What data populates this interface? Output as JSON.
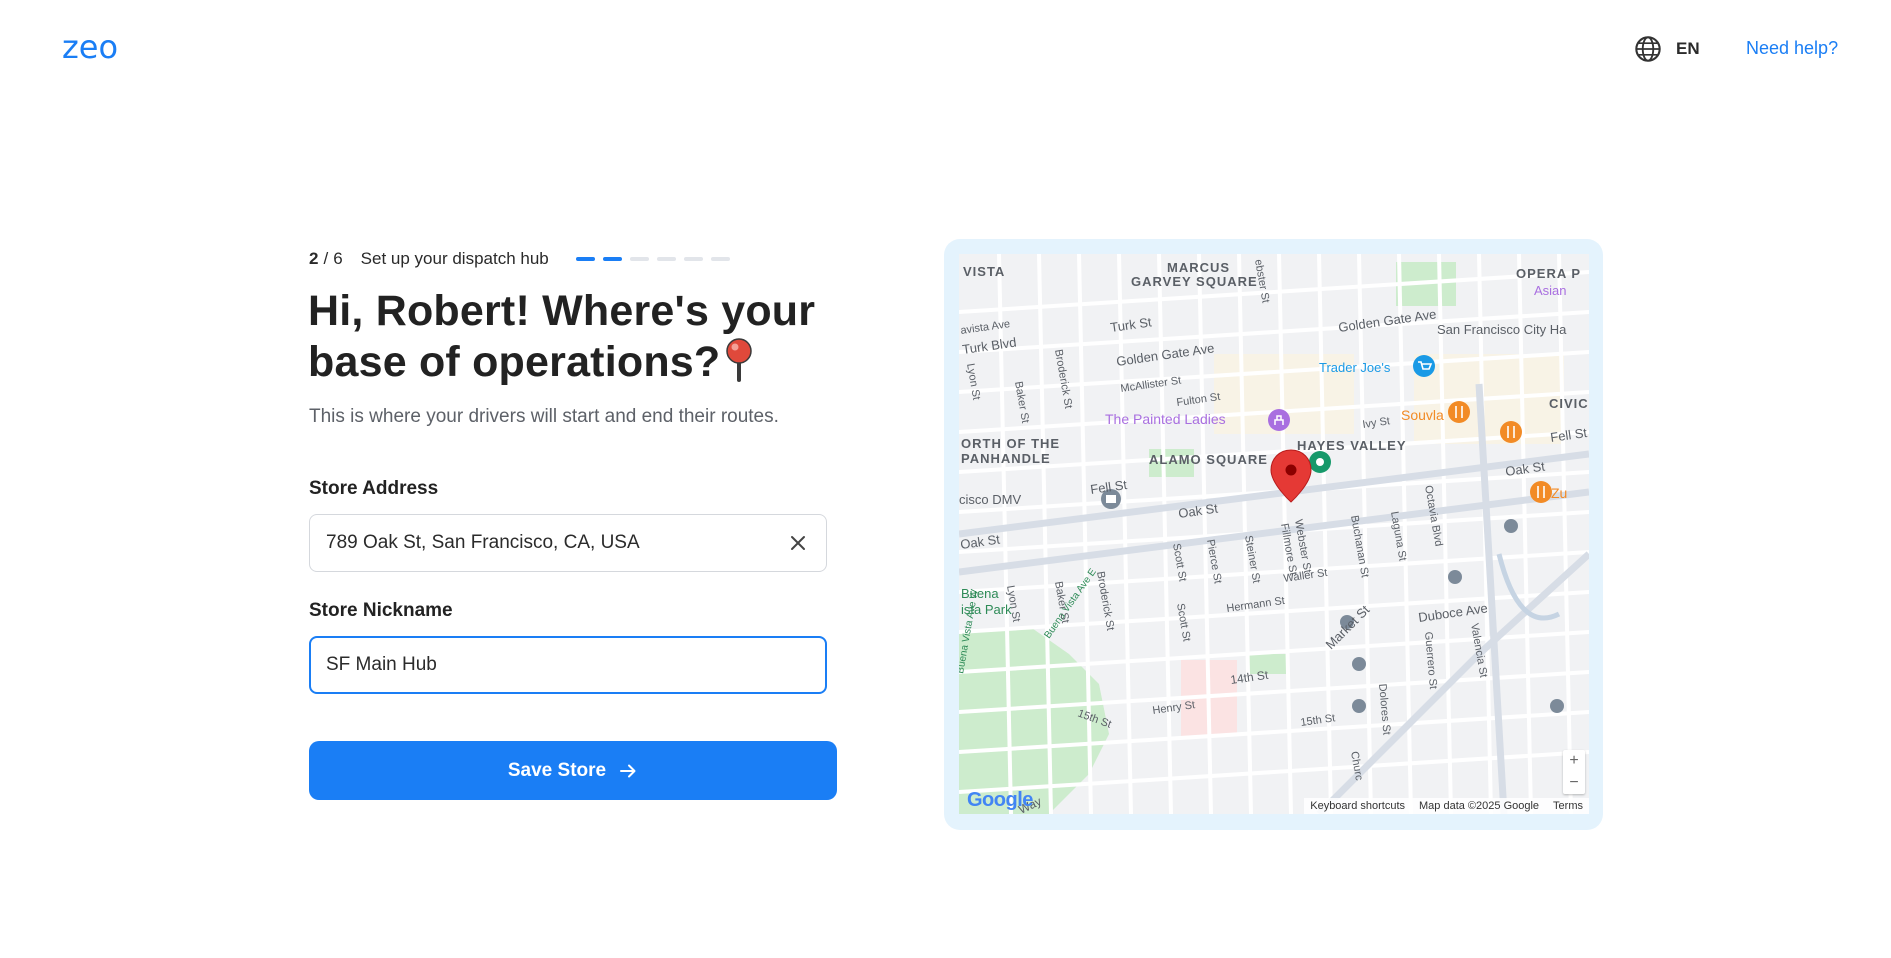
{
  "header": {
    "logo_text": "zeo",
    "language_code": "EN",
    "help_link": "Need help?"
  },
  "progress": {
    "current": "2",
    "separator": "/",
    "total": "6",
    "title": "Set up your dispatch hub",
    "completed_steps": 2,
    "step_count": 6
  },
  "content": {
    "heading": "Hi, Robert! Where's your base of operations?",
    "subtitle": "This is where your drivers will start and end their routes."
  },
  "form": {
    "address_label": "Store Address",
    "address_value": "789 Oak St, San Francisco, CA, USA",
    "nickname_label": "Store Nickname",
    "nickname_value": "SF Main Hub",
    "save_label": "Save Store"
  },
  "map": {
    "labels": {
      "vista": "VISTA",
      "marcus": "MARCUS",
      "garvey": "GARVEY SQUARE",
      "opera": "OPERA P",
      "asian": "Asian",
      "vista_ave": "avista Ave",
      "turk_blvd": "Turk Blvd",
      "turk_st": "Turk St",
      "golden_gate_ave": "Golden Gate Ave",
      "golden_gate_ave2": "Golden Gate Ave",
      "sf_city_hall": "San Francisco City Ha",
      "trader_joes": "Trader Joe's",
      "mcallister": "McAllister St",
      "fulton": "Fulton St",
      "painted_ladies": "The Painted Ladies",
      "souvla": "Souvla",
      "civic": "CIVIC",
      "ivy": "Ivy St",
      "hayes_valley": "HAYES VALLEY",
      "north_of": "ORTH OF THE",
      "panhandle": "PANHANDLE",
      "alamo": "ALAMO SQUARE",
      "fell_st": "Fell St",
      "fell_st2": "Fell St",
      "oak_st": "Oak St",
      "oak_st2": "Oak St",
      "oak_st3": "Oak St",
      "dmv": "cisco DMV",
      "zu": "Zu",
      "buena": "Buena",
      "vista_park": "ista Park",
      "waller": "Waller St",
      "hermann": "Hermann St",
      "duboce": "Duboce Ave",
      "market": "Market St",
      "fourteenth": "14th St",
      "fifteenth": "15th St",
      "fifteenth2": "15th St",
      "henry": "Henry St",
      "broderick": "Broderick St",
      "broderick2": "Broderick St",
      "baker": "Baker St",
      "baker2": "Baker St",
      "lyon": "Lyon St",
      "lyon2": "Lyon St",
      "webster": "ebster St",
      "webster2": "Webster St",
      "scott": "Scott St",
      "scott2": "Scott St",
      "pierce": "Pierce St",
      "steiner": "Steiner St",
      "fillmore": "Fillmore St",
      "buchanan": "Buchanan St",
      "laguna": "Laguna St",
      "octavia": "Octavia Blvd",
      "guerrero": "Guerrero St",
      "valencia": "Valencia St",
      "dolores": "Dolores St",
      "church": "Churc",
      "buena_vista_e": "Buena Vista Ave E",
      "buena_vista_w": "Buena Vista Ave W",
      "way": "Way"
    },
    "google_logo": "Google",
    "keyboard_shortcuts": "Keyboard shortcuts",
    "map_data": "Map data ©2025 Google",
    "terms": "Terms",
    "zoom_in": "+",
    "zoom_out": "−",
    "colors": {
      "pin": "#e53935",
      "water_green": "#cdeccd",
      "place_purple": "#a96fe0",
      "food_orange": "#f28b26",
      "shop_blue": "#1a9ae6",
      "park_teal": "#16996a"
    }
  },
  "colors": {
    "accent": "#1a7ef5",
    "frame": "#e4f3fd"
  }
}
